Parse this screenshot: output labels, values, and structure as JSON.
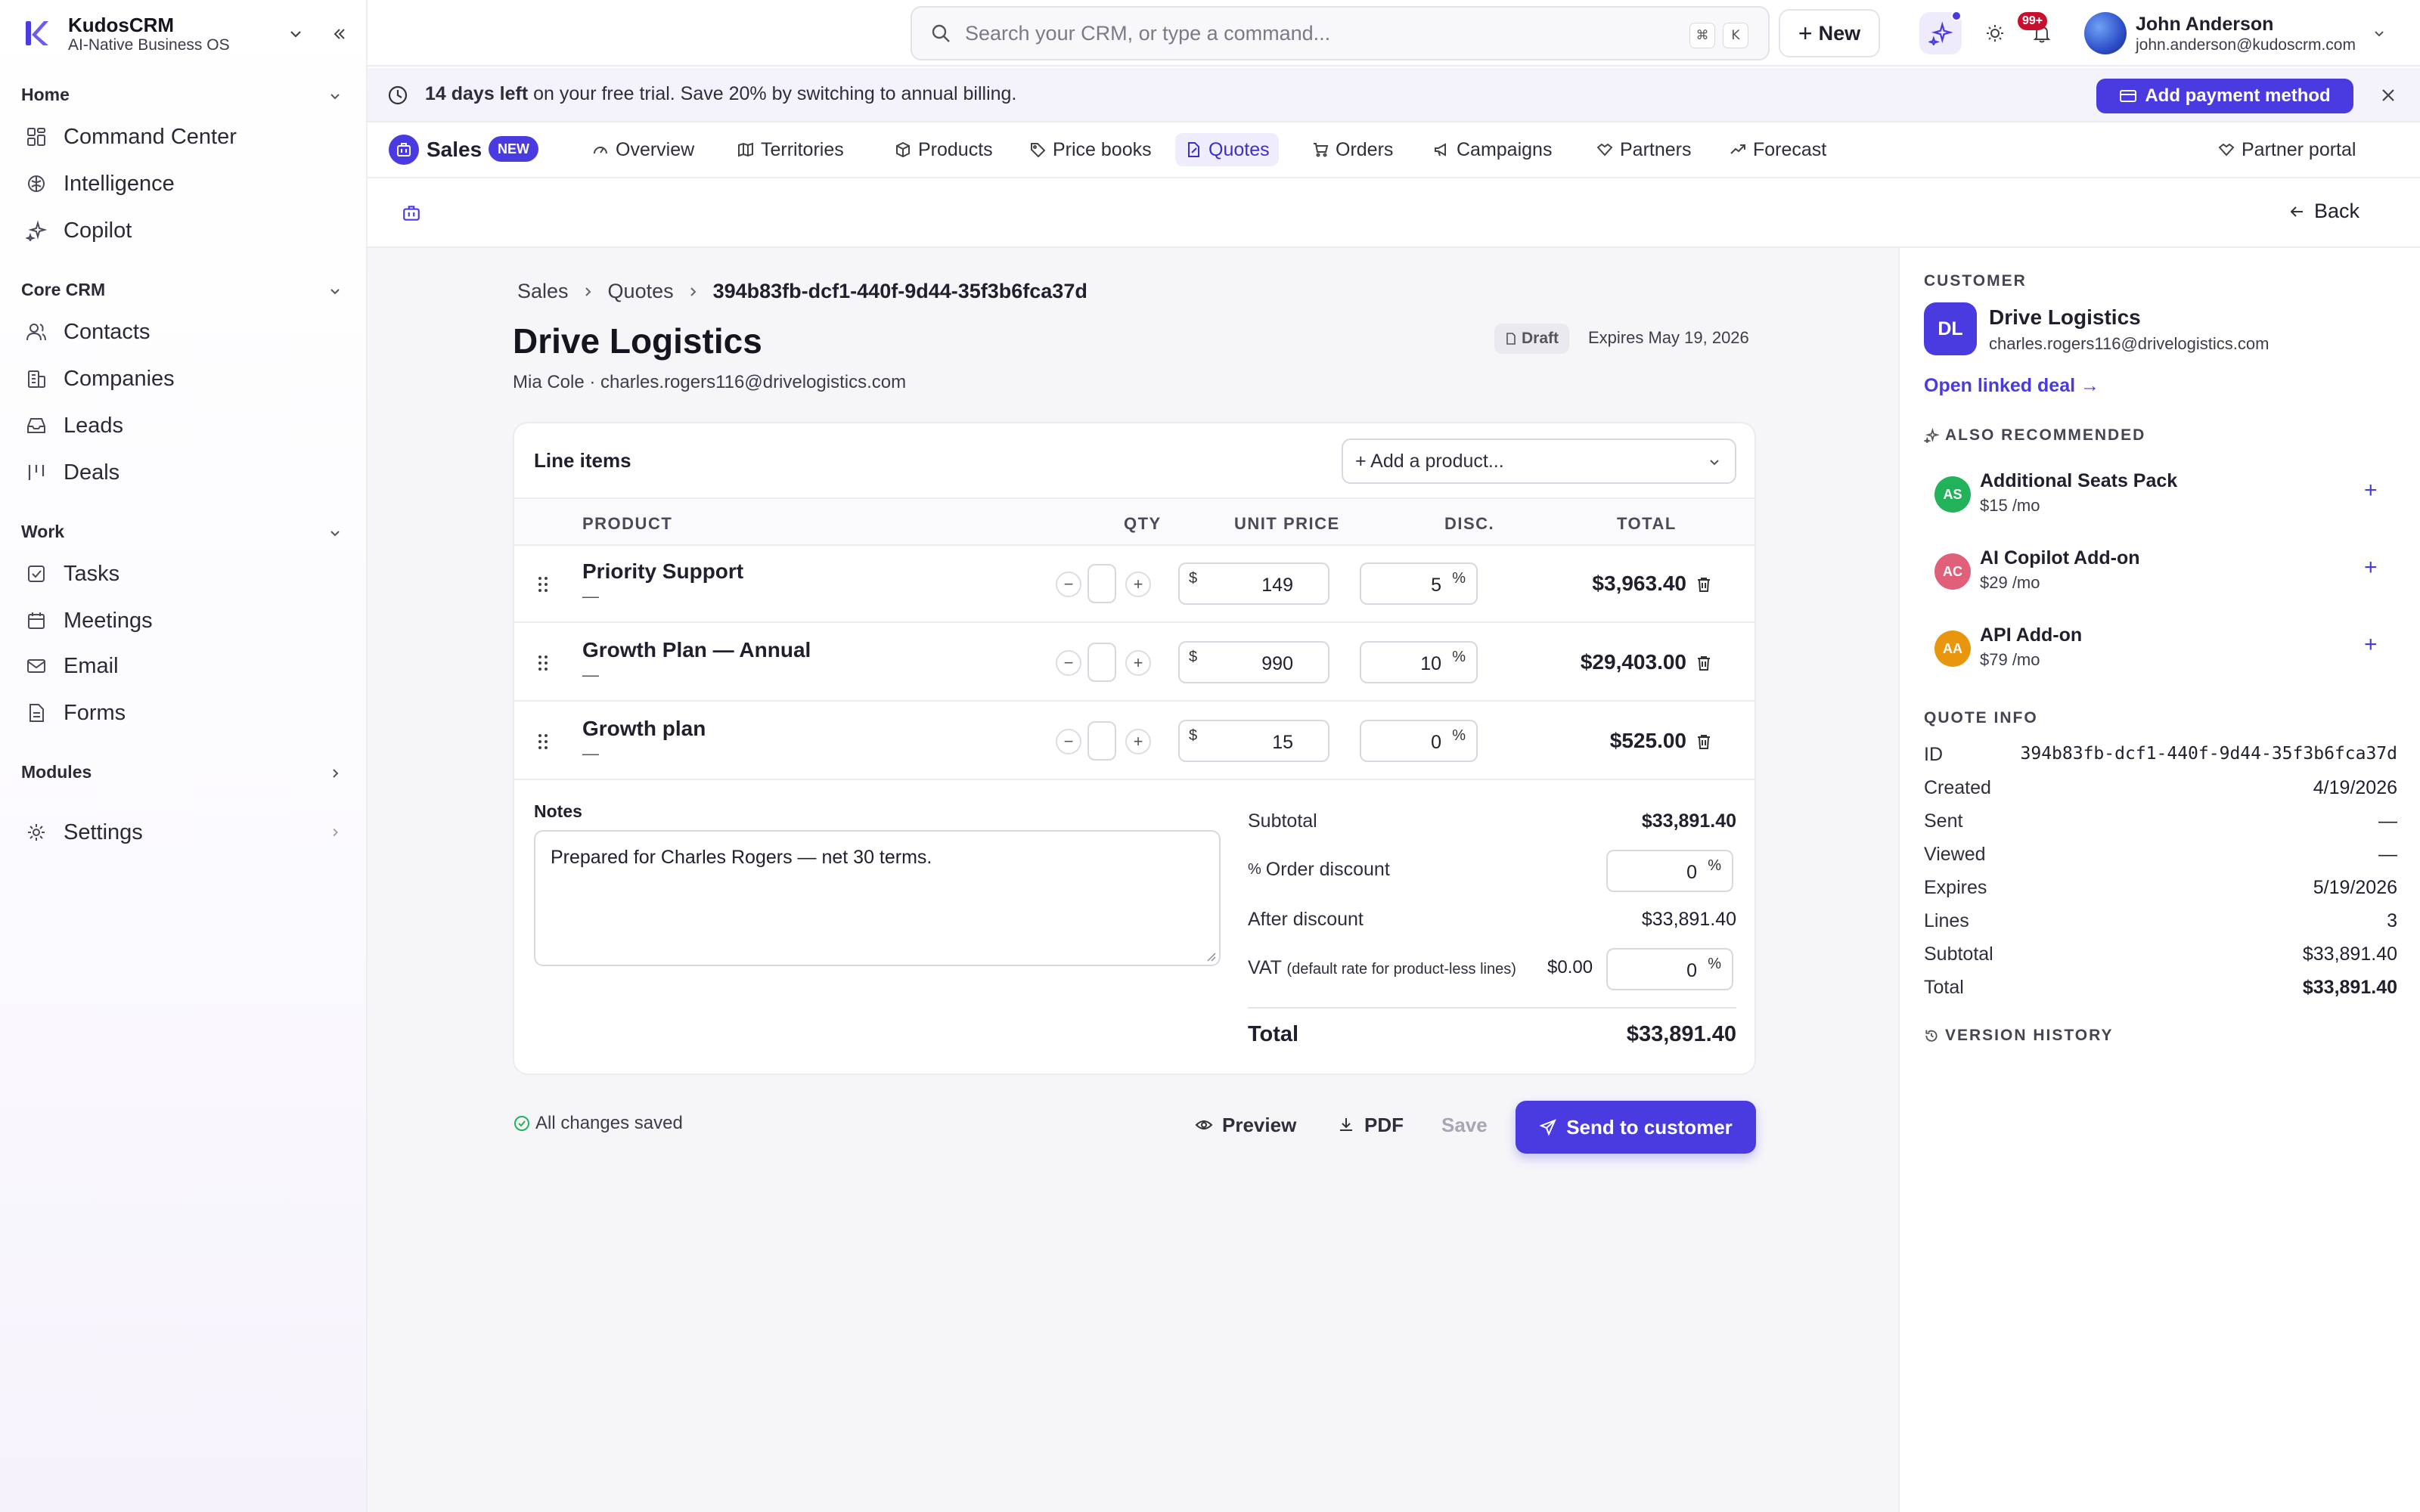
{
  "app": {
    "name": "KudosCRM",
    "tagline": "AI-Native Business OS"
  },
  "sidebar": {
    "sections": [
      {
        "title": "Home",
        "items": [
          {
            "label": "Command Center",
            "icon": "grid-icon"
          },
          {
            "label": "Intelligence",
            "icon": "brain-icon"
          },
          {
            "label": "Copilot",
            "icon": "sparkles-icon"
          }
        ]
      },
      {
        "title": "Core CRM",
        "items": [
          {
            "label": "Contacts",
            "icon": "users-icon"
          },
          {
            "label": "Companies",
            "icon": "building-icon"
          },
          {
            "label": "Leads",
            "icon": "inbox-icon"
          },
          {
            "label": "Deals",
            "icon": "kanban-icon"
          }
        ]
      },
      {
        "title": "Work",
        "items": [
          {
            "label": "Tasks",
            "icon": "checkbox-icon"
          },
          {
            "label": "Meetings",
            "icon": "calendar-icon"
          },
          {
            "label": "Email",
            "icon": "mail-icon"
          },
          {
            "label": "Forms",
            "icon": "form-icon"
          }
        ]
      },
      {
        "title": "Modules",
        "items": []
      }
    ],
    "settings_label": "Settings"
  },
  "topbar": {
    "search_placeholder": "Search your CRM, or type a command...",
    "kbd": [
      "⌘",
      "K"
    ],
    "new_label": "New",
    "notifications_badge": "99+",
    "user": {
      "name": "John Anderson",
      "email": "john.anderson@kudoscrm.com"
    }
  },
  "banner": {
    "bold": "14 days left",
    "text": " on your free trial. Save 20% by switching to annual billing.",
    "button": "Add payment method"
  },
  "module": {
    "name": "Sales",
    "badge": "NEW",
    "tabs": [
      "Overview",
      "Territories",
      "Products",
      "Price books",
      "Quotes",
      "Orders",
      "Campaigns",
      "Partners",
      "Forecast"
    ],
    "active_tab": "Quotes",
    "partner_portal": "Partner portal"
  },
  "subheader": {
    "back": "Back"
  },
  "breadcrumb": [
    "Sales",
    "Quotes",
    "394b83fb-dcf1-440f-9d44-35f3b6fca37d"
  ],
  "quote": {
    "title": "Drive Logistics",
    "subtitle": "Mia Cole · charles.rogers116@drivelogistics.com",
    "status": "Draft",
    "expires": "Expires May 19, 2026"
  },
  "line_items": {
    "title": "Line items",
    "add_product": "+ Add a product...",
    "headers": {
      "product": "PRODUCT",
      "qty": "QTY",
      "unit_price": "UNIT PRICE",
      "disc": "DISC.",
      "total": "TOTAL"
    },
    "currency_symbol": "$",
    "percent_symbol": "%",
    "rows": [
      {
        "name": "Priority Support",
        "sub": "—",
        "unit_price": "149",
        "discount": "5",
        "total": "$3,963.40"
      },
      {
        "name": "Growth Plan — Annual",
        "sub": "—",
        "unit_price": "990",
        "discount": "10",
        "total": "$29,403.00"
      },
      {
        "name": "Growth plan",
        "sub": "—",
        "unit_price": "15",
        "discount": "0",
        "total": "$525.00"
      }
    ]
  },
  "notes": {
    "label": "Notes",
    "value": "Prepared for Charles Rogers — net 30 terms."
  },
  "summary": {
    "subtotal_label": "Subtotal",
    "subtotal": "$33,891.40",
    "order_discount_label": "Order discount",
    "order_discount": "0",
    "after_discount_label": "After discount",
    "after_discount": "$33,891.40",
    "vat_label": "VAT",
    "vat_note": "(default rate for product-less lines)",
    "vat_amount": "$0.00",
    "vat_rate": "0",
    "total_label": "Total",
    "total": "$33,891.40"
  },
  "footer": {
    "saved": "All changes saved",
    "preview": "Preview",
    "pdf": "PDF",
    "save": "Save",
    "send": "Send to customer"
  },
  "aside": {
    "customer_caption": "CUSTOMER",
    "customer": {
      "initials": "DL",
      "name": "Drive Logistics",
      "email": "charles.rogers116@drivelogistics.com"
    },
    "linked_deal": "Open linked deal →",
    "recommended_caption": "ALSO RECOMMENDED",
    "recommended": [
      {
        "initials": "AS",
        "name": "Additional Seats Pack",
        "price": "$15 /mo",
        "color": "#22b35a"
      },
      {
        "initials": "AC",
        "name": "AI Copilot Add-on",
        "price": "$29 /mo",
        "color": "#e0607a"
      },
      {
        "initials": "AA",
        "name": "API Add-on",
        "price": "$79 /mo",
        "color": "#e8960e"
      }
    ],
    "info_caption": "QUOTE INFO",
    "info": [
      {
        "label": "ID",
        "value": "394b83fb-dcf1-440f-9d44-35f3b6fca37d"
      },
      {
        "label": "Created",
        "value": "4/19/2026"
      },
      {
        "label": "Sent",
        "value": "—"
      },
      {
        "label": "Viewed",
        "value": "—"
      },
      {
        "label": "Expires",
        "value": "5/19/2026"
      },
      {
        "label": "Lines",
        "value": "3"
      },
      {
        "label": "Subtotal",
        "value": "$33,891.40"
      },
      {
        "label": "Total",
        "value": "$33,891.40"
      }
    ],
    "version_history": "VERSION HISTORY"
  },
  "colors": {
    "accent": "#4a3be0",
    "success": "#22b35a"
  }
}
